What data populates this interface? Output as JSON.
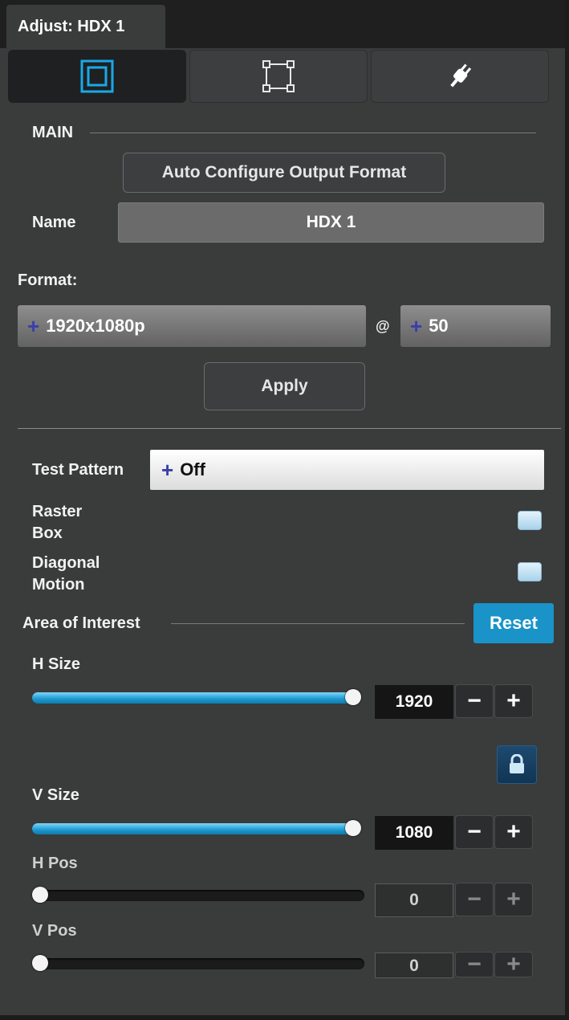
{
  "panel": {
    "tab_title": "Adjust: HDX 1",
    "segments": [
      {
        "icon": "frame-square-icon",
        "active": true
      },
      {
        "icon": "crop-corners-icon",
        "active": false
      },
      {
        "icon": "plug-icon",
        "active": false
      }
    ]
  },
  "main": {
    "section_title": "MAIN",
    "auto_configure_label": "Auto Configure Output Format",
    "name_label": "Name",
    "name_value": "HDX 1",
    "format_label": "Format:",
    "resolution_value": "1920x1080p",
    "at_sign": "@",
    "rate_value": "50",
    "plus_symbol": "+",
    "apply_label": "Apply"
  },
  "test": {
    "test_pattern_label": "Test Pattern",
    "test_pattern_value": "Off",
    "raster_box_label_1": "Raster",
    "raster_box_label_2": "Box",
    "diagonal_motion_label_1": "Diagonal",
    "diagonal_motion_label_2": "Motion"
  },
  "aoi": {
    "section_title": "Area of Interest",
    "reset_label": "Reset",
    "minus_symbol": "−",
    "plus_symbol": "+",
    "h_size": {
      "label": "H Size",
      "value": "1920",
      "level": 1.0
    },
    "v_size": {
      "label": "V Size",
      "value": "1080",
      "level": 1.0
    },
    "h_pos": {
      "label": "H Pos",
      "value": "0",
      "level": 0.0
    },
    "v_pos": {
      "label": "V Pos",
      "value": "0",
      "level": 0.0
    }
  },
  "colors": {
    "accent": "#1a93c9",
    "panel_bg": "#3a3b3b",
    "active_icon": "#1aa8e8"
  }
}
